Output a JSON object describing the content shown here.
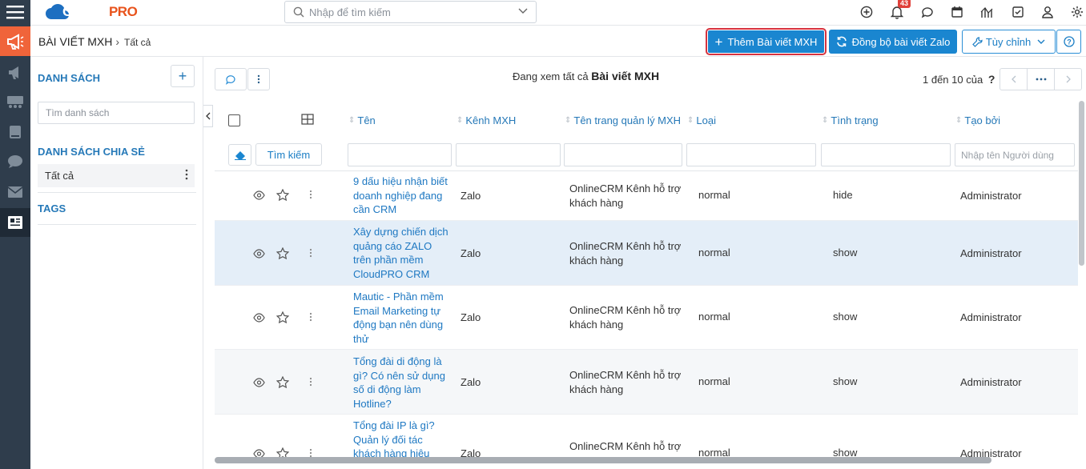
{
  "app": {
    "logo_text": "CLOUD",
    "logo_text_bold": "PRO"
  },
  "search": {
    "placeholder": "Nhập để tìm kiếm"
  },
  "notifications": {
    "count": "43"
  },
  "breadcrumb": {
    "module": "BÀI VIẾT MXH",
    "current": "Tất cả"
  },
  "actions": {
    "add_label": "Thêm Bài viết MXH",
    "sync_label": "Đồng bộ bài viết Zalo",
    "customize_label": "Tùy chỉnh"
  },
  "leftpanel": {
    "lists_title": "DANH SÁCH",
    "search_placeholder": "Tìm danh sách",
    "shared_title": "DANH SÁCH CHIA SẺ",
    "shared_item": "Tất cả",
    "tags_title": "TAGS"
  },
  "main": {
    "viewing_prefix": "Đang xem tất cả",
    "viewing_module": "Bài viết MXH",
    "pager_text": "1 đến 10 của",
    "pager_help": "?"
  },
  "table": {
    "headers": [
      "Tên",
      "Kênh MXH",
      "Tên trang quản lý MXH",
      "Loại",
      "Tình trạng",
      "Tạo bởi"
    ],
    "search_button": "Tìm kiếm",
    "created_by_placeholder": "Nhập tên Người dùng",
    "rows": [
      {
        "name": "9 dấu hiệu nhận biết doanh nghiệp đang cần CRM",
        "channel": "Zalo",
        "page": "OnlineCRM Kênh hỗ trợ khách hàng",
        "type": "normal",
        "status": "hide",
        "created_by": "Administrator"
      },
      {
        "name": "Xây dựng chiến dịch quảng cáo ZALO trên phần mềm CloudPRO CRM",
        "channel": "Zalo",
        "page": "OnlineCRM Kênh hỗ trợ khách hàng",
        "type": "normal",
        "status": "show",
        "created_by": "Administrator"
      },
      {
        "name": "Mautic - Phần mềm Email Marketing tự động bạn nên dùng thử",
        "channel": "Zalo",
        "page": "OnlineCRM Kênh hỗ trợ khách hàng",
        "type": "normal",
        "status": "show",
        "created_by": "Administrator"
      },
      {
        "name": "Tổng đài di động là gì? Có nên sử dụng số di động làm Hotline?",
        "channel": "Zalo",
        "page": "OnlineCRM Kênh hỗ trợ khách hàng",
        "type": "normal",
        "status": "show",
        "created_by": "Administrator"
      },
      {
        "name": "Tổng đài IP là gì? Quản lý đối tác khách hàng hiệu",
        "channel": "Zalo",
        "page": "OnlineCRM Kênh hỗ trợ",
        "type": "normal",
        "status": "show",
        "created_by": "Administrator"
      }
    ]
  },
  "colors": {
    "rail": "#2f3d4c",
    "accent": "#1a86d0",
    "highlight_row": "#e4eef8",
    "active_rail": "#f0643a"
  }
}
